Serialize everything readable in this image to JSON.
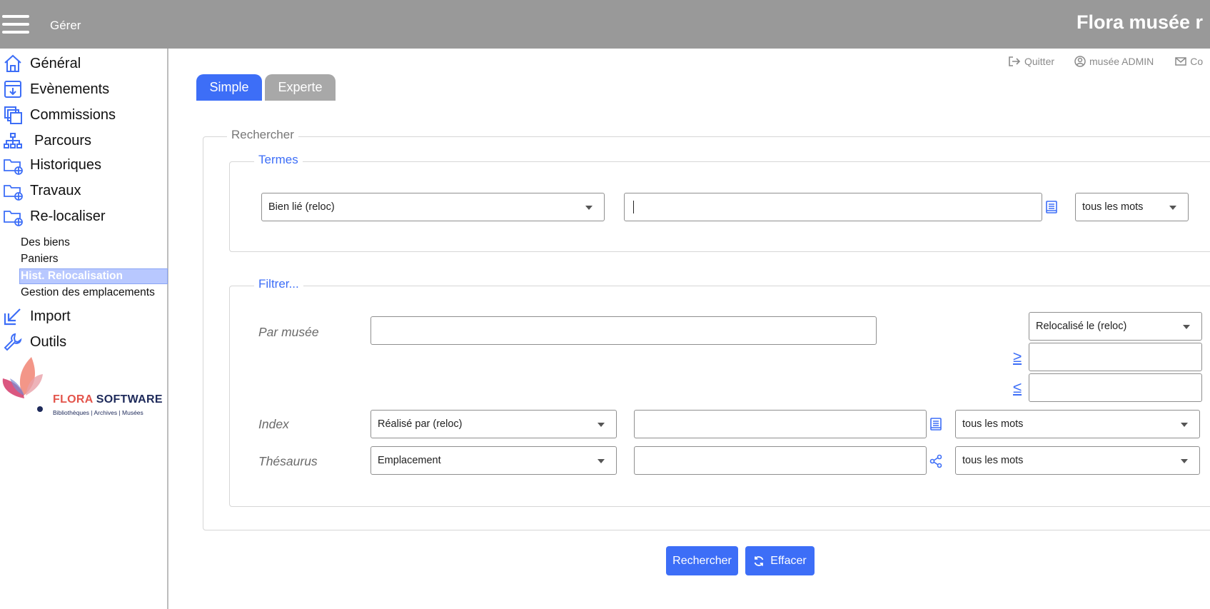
{
  "header": {
    "menu_label": "Gérer",
    "title": "Flora musée r"
  },
  "sidebar": {
    "items": [
      {
        "label": "Général",
        "icon": "home-icon"
      },
      {
        "label": "Evènements",
        "icon": "inbox-download-icon"
      },
      {
        "label": "Commissions",
        "icon": "copy-stack-icon"
      },
      {
        "label": "Parcours",
        "icon": "sitemap-icon"
      },
      {
        "label": "Historiques",
        "icon": "folder-globe-icon"
      },
      {
        "label": "Travaux",
        "icon": "folder-globe-icon"
      },
      {
        "label": "Re-localiser",
        "icon": "folder-globe-icon"
      }
    ],
    "subitems": [
      {
        "label": "Des biens"
      },
      {
        "label": "Paniers"
      },
      {
        "label": "Hist. Relocalisation",
        "active": true
      },
      {
        "label": "Gestion des emplacements"
      }
    ],
    "bottom_items": [
      {
        "label": "Import",
        "icon": "import-arrow-icon"
      },
      {
        "label": "Outils",
        "icon": "wrench-icon"
      }
    ],
    "logo": {
      "brand_part1": "FLORA",
      "brand_part2": " SOFTWARE",
      "tagline": "Bibliothèques | Archives | Musées"
    }
  },
  "user_links": {
    "quit": "Quitter",
    "user": "musée ADMIN",
    "contact": "Co"
  },
  "tabs": {
    "simple": "Simple",
    "expert": "Experte"
  },
  "search": {
    "legend": "Rechercher",
    "termes": {
      "legend": "Termes",
      "field_select": "Bien lié (reloc)",
      "value": "",
      "mode_select": "tous les mots"
    },
    "filter": {
      "legend": "Filtrer...",
      "museum_label": "Par musée",
      "museum_value": "",
      "date_select": "Relocalisé le (reloc)",
      "ge_symbol": "≥",
      "le_symbol": "≤",
      "index_label": "Index",
      "index_select": "Réalisé par (reloc)",
      "index_mode": "tous les mots",
      "thesaurus_label": "Thésaurus",
      "thesaurus_select": "Emplacement",
      "thesaurus_mode": "tous les mots"
    },
    "buttons": {
      "search": "Rechercher",
      "clear": "Effacer"
    }
  },
  "colors": {
    "accent": "#3d6ef7",
    "topbar": "#999999",
    "active_subitem": "#b8c8ff"
  }
}
